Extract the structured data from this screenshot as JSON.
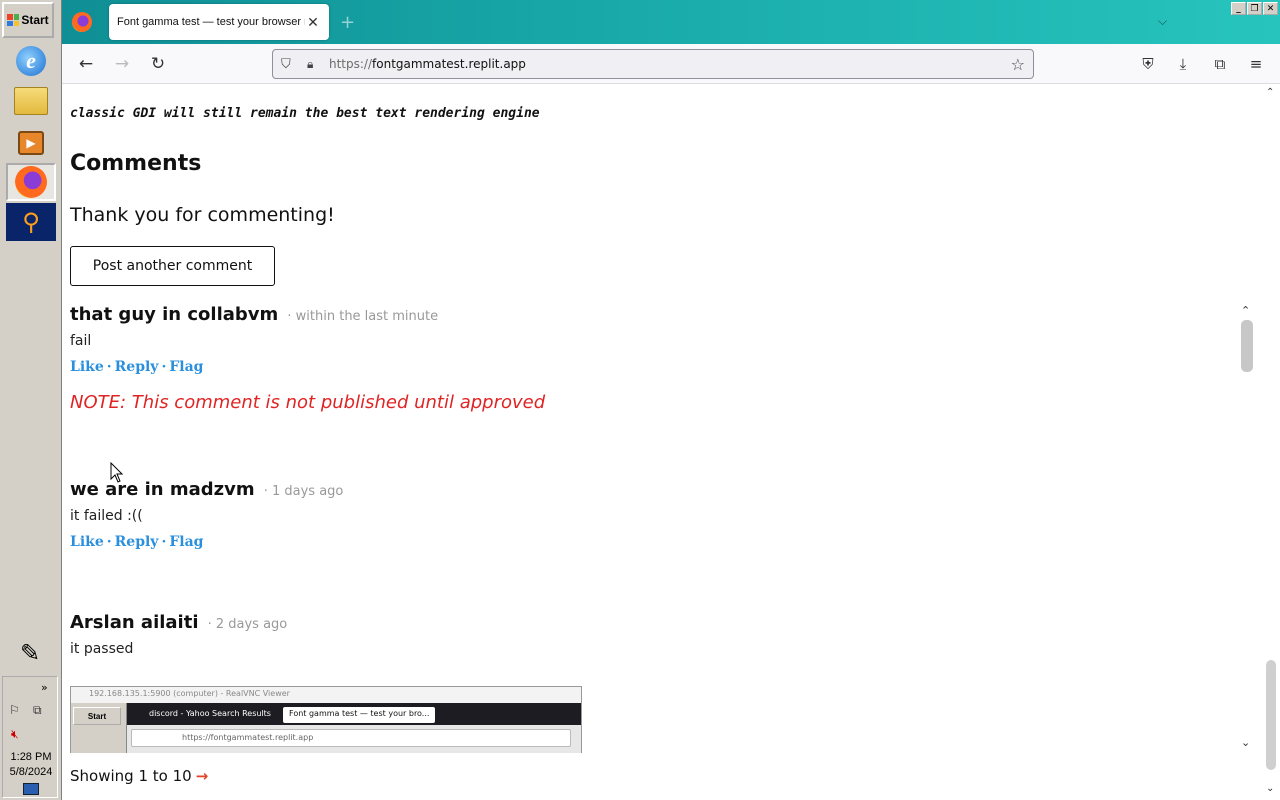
{
  "taskbar": {
    "start_label": "Start",
    "clock_time": "1:28 PM",
    "clock_date": "5/8/2024",
    "tray_expand": "»"
  },
  "browser": {
    "tab_title": "Font gamma test — test your browser rendering",
    "tab_close": "✕",
    "new_tab": "+",
    "list_tabs": "⌵",
    "url_scheme": "https://",
    "url_host": "fontgammatest.replit.app",
    "window_controls": [
      "_",
      "❐",
      "✕"
    ]
  },
  "page": {
    "mono_line": "classic GDI will still remain the best text rendering engine",
    "comments_heading": "Comments",
    "thanks_text": "Thank you for commenting!",
    "post_button": "Post another comment",
    "showing_text": "Showing 1 to 10",
    "showing_arrow": "→"
  },
  "comments": [
    {
      "author": "that guy in collabvm",
      "time": "· within the last minute",
      "body": "fail",
      "like": "Like",
      "reply": "Reply",
      "flag": "Flag",
      "note": "NOTE: This comment is not published until approved"
    },
    {
      "author": "we are in madzvm",
      "time": "· 1 days ago",
      "body": "it failed :((",
      "like": "Like",
      "reply": "Reply",
      "flag": "Flag"
    },
    {
      "author": "Arslan ailaiti",
      "time": "· 2 days ago",
      "body": "it passed"
    }
  ],
  "embedded_screenshot": {
    "title": "192.168.135.1:5900 (computer) - RealVNC Viewer",
    "start_label": "Start",
    "tab1": "discord - Yahoo Search Results",
    "tab2": "Font gamma test — test your bro...",
    "url": "https://fontgammatest.replit.app"
  },
  "separator": "·"
}
